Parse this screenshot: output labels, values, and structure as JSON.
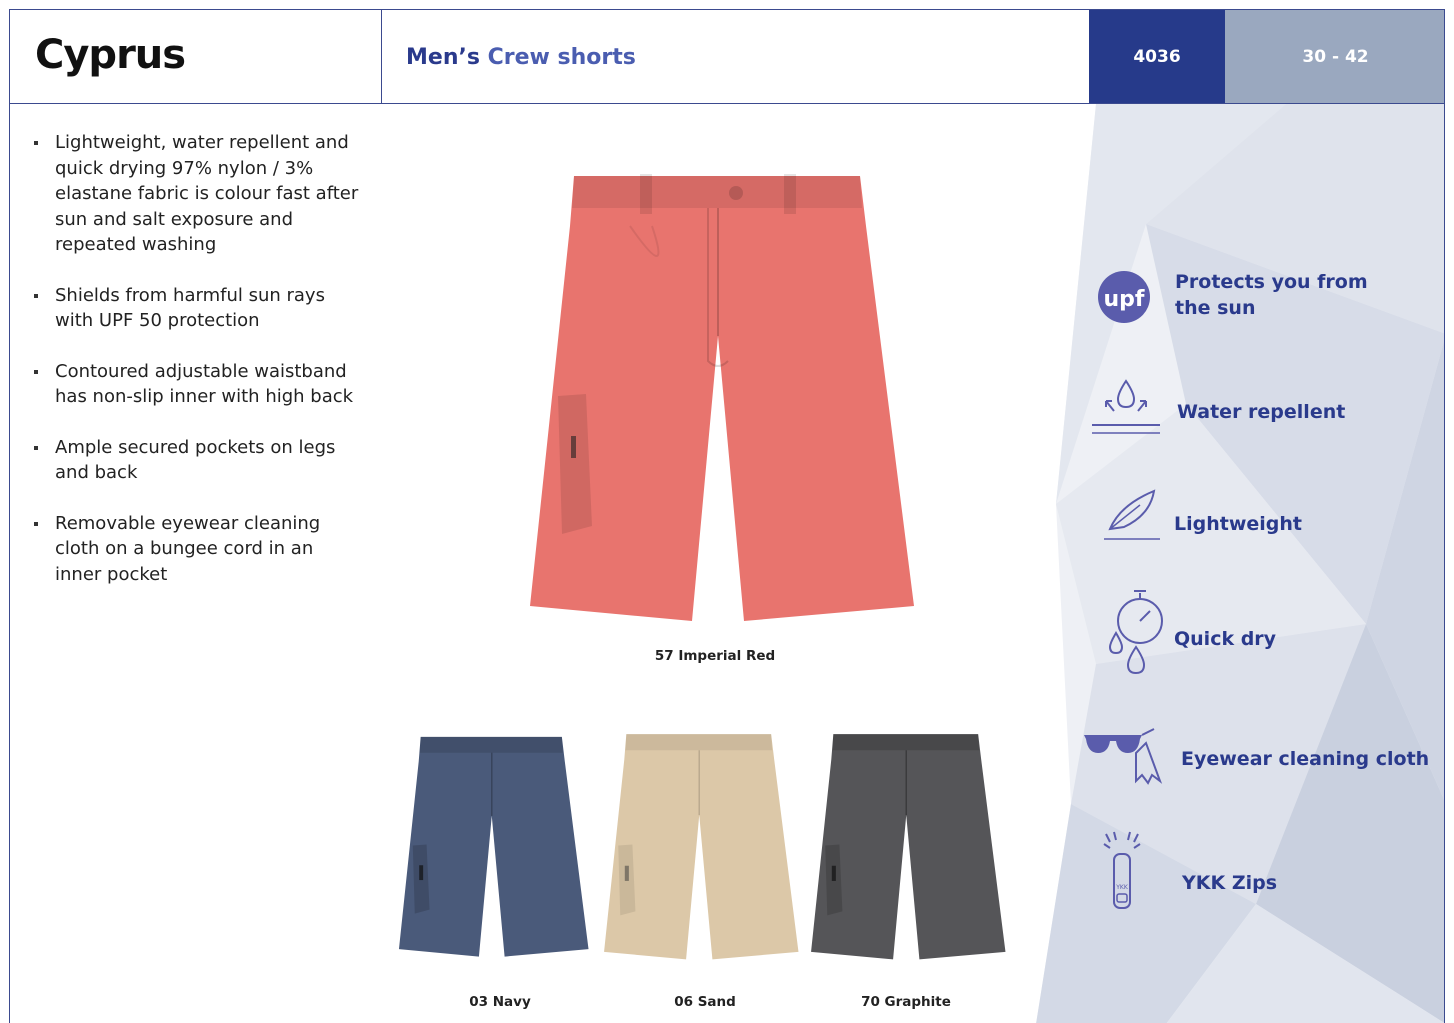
{
  "header": {
    "product_name": "Cyprus",
    "subtitle_prefix": "Men’s",
    "subtitle_rest": "Crew shorts",
    "style_code": "4036",
    "size_range": "30 - 42"
  },
  "features": [
    "Lightweight, water repellent and quick drying 97% nylon / 3% elastane fabric is colour fast after sun and salt exposure and repeated washing",
    "Shields from harmful sun rays with UPF 50 protection",
    "Contoured adjustable waistband has non-slip inner with high back",
    "Ample secured pockets on legs and back",
    "Removable eyewear cleaning cloth on a bungee cord in an inner pocket"
  ],
  "colours": {
    "main": {
      "label": "57 Imperial Red",
      "hex": "#e8746e"
    },
    "others": [
      {
        "label": "03 Navy",
        "hex": "#4a5a7a"
      },
      {
        "label": "06 Sand",
        "hex": "#dcc8a8"
      },
      {
        "label": "70 Graphite",
        "hex": "#555558"
      }
    ]
  },
  "benefits": [
    {
      "icon": "upf-icon",
      "icon_text": "upf",
      "label": "Protects you from the sun"
    },
    {
      "icon": "water-repellent-icon",
      "label": "Water repellent"
    },
    {
      "icon": "feather-icon",
      "label": "Lightweight"
    },
    {
      "icon": "stopwatch-drops-icon",
      "label": "Quick dry"
    },
    {
      "icon": "sunglasses-cloth-icon",
      "label": "Eyewear cleaning cloth"
    },
    {
      "icon": "zip-pull-icon",
      "icon_text": "YKK",
      "label": "YKK Zips"
    }
  ],
  "theme": {
    "brand_blue": "#263a8c",
    "icon_purple": "#5a5cac",
    "size_grey": "#9aa8bf"
  }
}
